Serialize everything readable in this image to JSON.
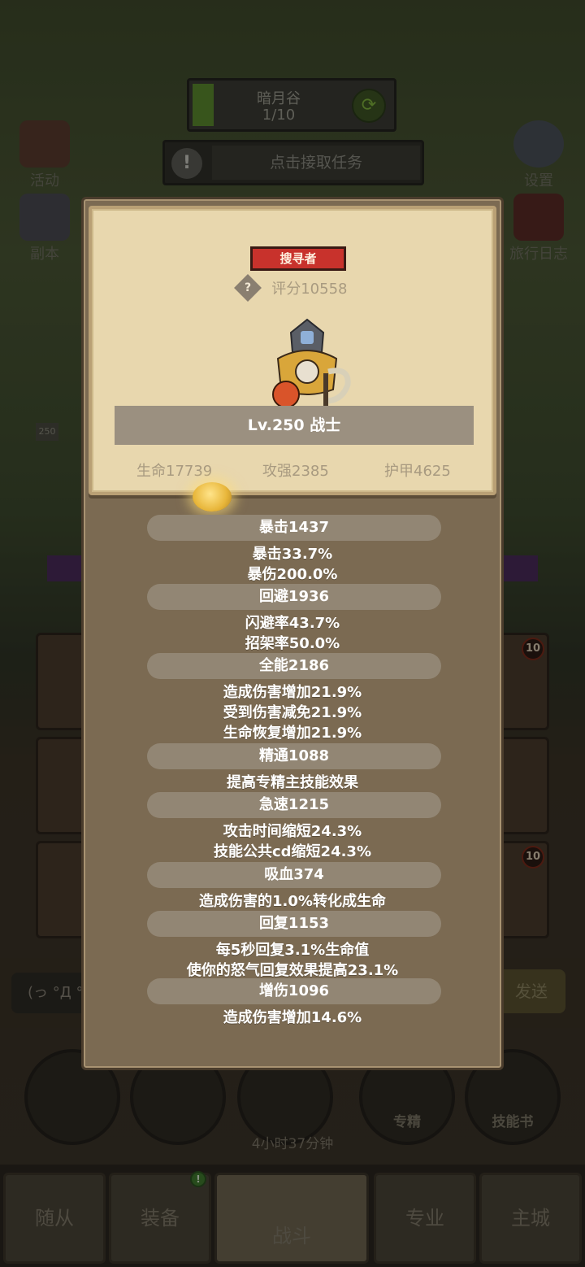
{
  "scene": {
    "zone_name": "暗月谷",
    "zone_progress": "1/10",
    "task_text": "点击接取任务",
    "left_buttons": [
      "活动",
      "副本"
    ],
    "right_buttons": [
      "设置",
      "旅行日志"
    ],
    "level_small": "250",
    "card_badge": "10",
    "chat_placeholder": "(っ °Д °",
    "chat_send": "发送",
    "round_buttons": [
      "专精",
      "技能书"
    ],
    "timer": "4小时37分钟",
    "nav_tabs": [
      "随从",
      "装备",
      "战斗",
      "专业",
      "主城"
    ],
    "nav_dot": "!"
  },
  "panel": {
    "title_badge": "搜寻者",
    "score_icon": "?",
    "score": "评分10558",
    "level_class": "Lv.250 战士",
    "hp": "生命17739",
    "attack": "攻强2385",
    "armor": "护甲4625",
    "groups": [
      {
        "head": "暴击1437",
        "lines": [
          "暴击33.7%",
          "暴伤200.0%"
        ]
      },
      {
        "head": "回避1936",
        "lines": [
          "闪避率43.7%",
          "招架率50.0%"
        ]
      },
      {
        "head": "全能2186",
        "lines": [
          "造成伤害增加21.9%",
          "受到伤害减免21.9%",
          "生命恢复增加21.9%"
        ]
      },
      {
        "head": "精通1088",
        "lines": [
          "提高专精主技能效果"
        ]
      },
      {
        "head": "急速1215",
        "lines": [
          "攻击时间缩短24.3%",
          "技能公共cd缩短24.3%"
        ]
      },
      {
        "head": "吸血374",
        "lines": [
          "造成伤害的1.0%转化成生命"
        ]
      },
      {
        "head": "回复1153",
        "lines": [
          "每5秒回复3.1%生命值",
          "使你的怒气回复效果提高23.1%"
        ]
      },
      {
        "head": "增伤1096",
        "lines": [
          "造成伤害增加14.6%"
        ]
      }
    ]
  },
  "colors": {
    "panel_bg": "#7b6a52",
    "parchment": "#e8d7ae",
    "badge_red": "#c8322c",
    "group_head": "#928674"
  }
}
